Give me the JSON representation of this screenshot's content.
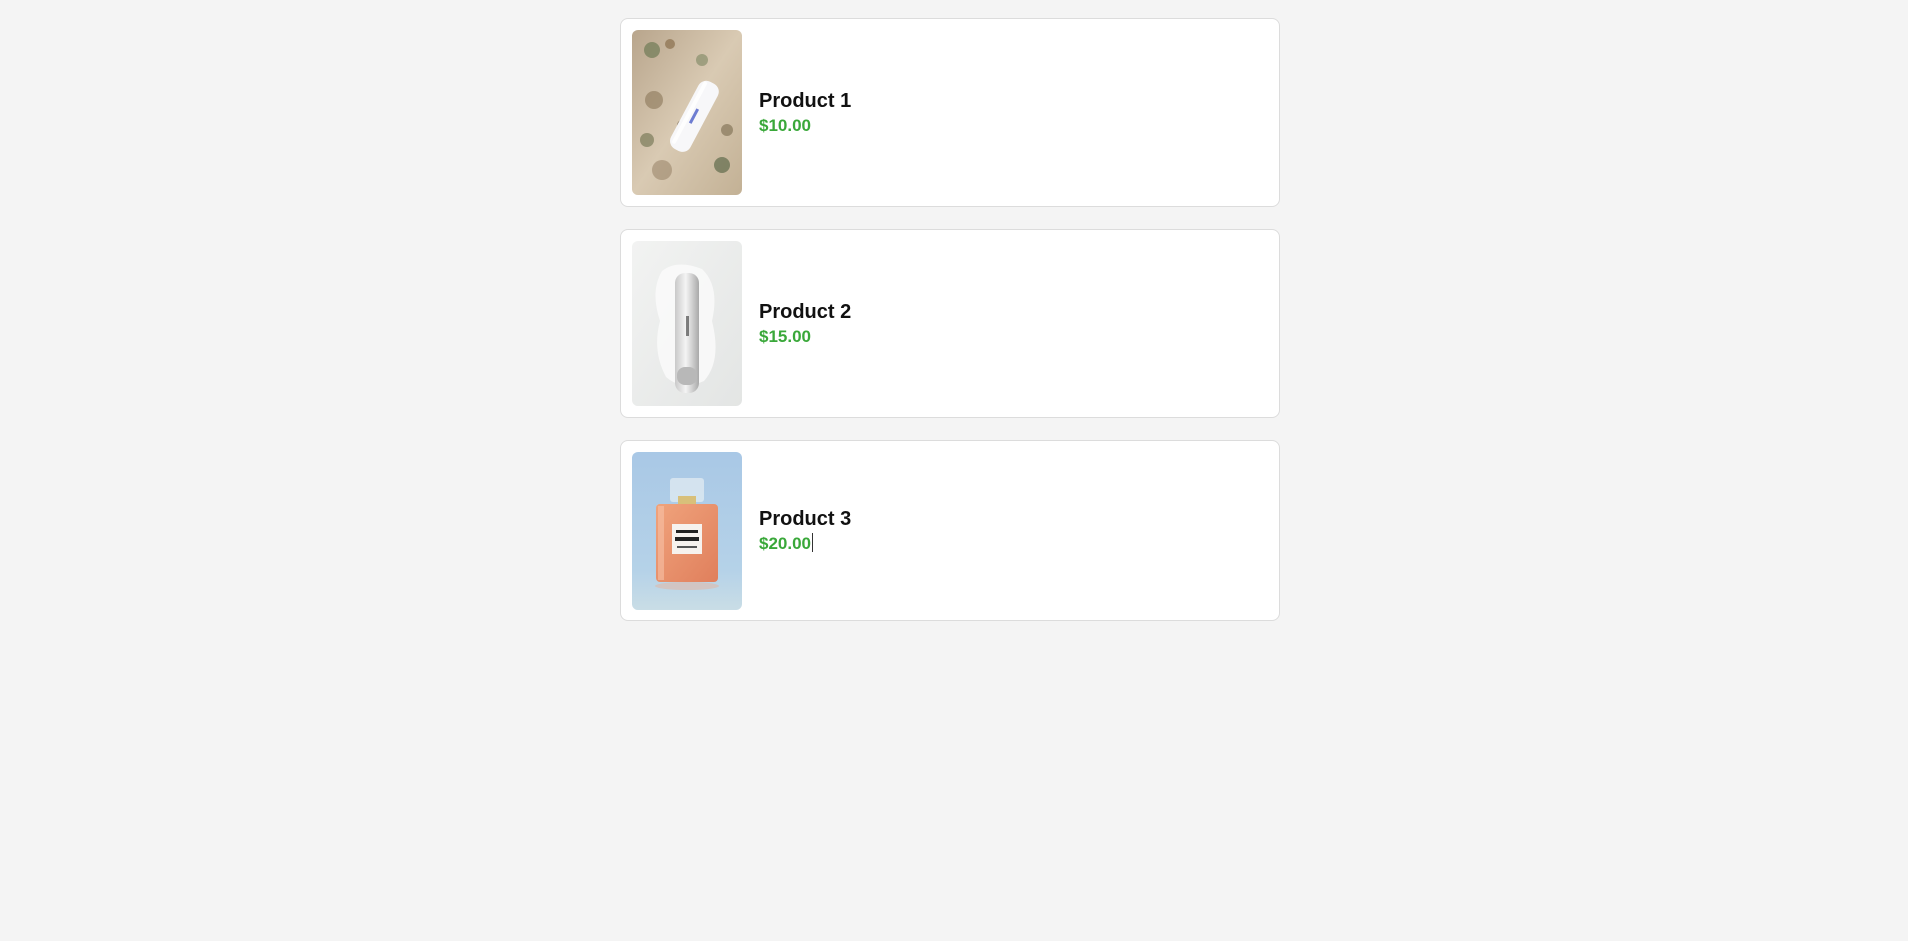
{
  "theme": {
    "background": "#f4f4f4",
    "card_background": "#ffffff",
    "card_border": "#dcdcdc",
    "title_color": "#111111",
    "price_color": "#3aa83a"
  },
  "products": [
    {
      "name": "Product 1",
      "price": "$10.00",
      "image_icon": "product-photo-white-tube-on-sand"
    },
    {
      "name": "Product 2",
      "price": "$15.00",
      "image_icon": "product-photo-silver-tube-on-white"
    },
    {
      "name": "Product 3",
      "price": "$20.00",
      "image_icon": "product-photo-perfume-bottle"
    }
  ],
  "text_caret_on_product": 3
}
